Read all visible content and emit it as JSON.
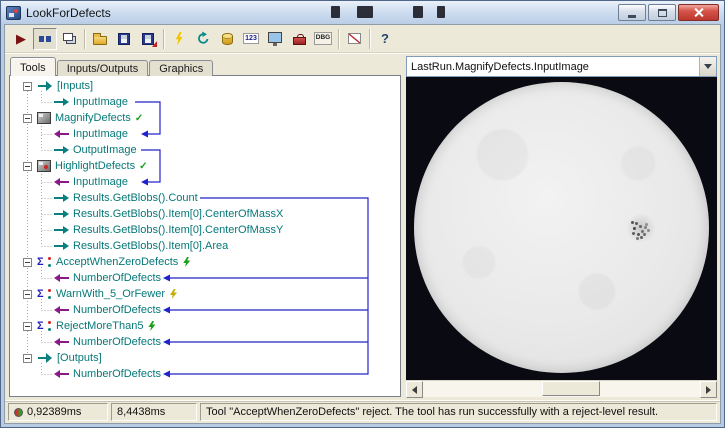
{
  "window": {
    "title": "LookForDefects"
  },
  "toolbar": {
    "buttons": [
      {
        "name": "run-job",
        "glyph": "▶"
      },
      {
        "name": "run-continuous",
        "glyph": ""
      },
      {
        "name": "show-windows",
        "glyph": ""
      },
      {
        "name": "open-job",
        "glyph": ""
      },
      {
        "name": "save-job",
        "glyph": ""
      },
      {
        "name": "save-image",
        "glyph": ""
      },
      {
        "name": "reset",
        "glyph": ""
      },
      {
        "name": "refresh",
        "glyph": ""
      },
      {
        "name": "database",
        "glyph": ""
      },
      {
        "name": "posted-values",
        "glyph": "123"
      },
      {
        "name": "image-display",
        "glyph": ""
      },
      {
        "name": "tool-options",
        "glyph": ""
      },
      {
        "name": "debug",
        "glyph": "DBG"
      },
      {
        "name": "profile",
        "glyph": ""
      },
      {
        "name": "help",
        "glyph": "?"
      }
    ]
  },
  "tabs": [
    {
      "label": "Tools"
    },
    {
      "label": "Inputs/Outputs"
    },
    {
      "label": "Graphics"
    }
  ],
  "icons": {
    "sigma": "Σ",
    "check": "✓"
  },
  "tree": {
    "items": [
      {
        "label": "[Inputs]"
      },
      {
        "label": "InputImage"
      },
      {
        "label": "MagnifyDefects"
      },
      {
        "label": "InputImage"
      },
      {
        "label": "OutputImage"
      },
      {
        "label": "HighlightDefects"
      },
      {
        "label": "InputImage"
      },
      {
        "label": "Results.GetBlobs().Count"
      },
      {
        "label": "Results.GetBlobs().Item[0].CenterOfMassX"
      },
      {
        "label": "Results.GetBlobs().Item[0].CenterOfMassY"
      },
      {
        "label": "Results.GetBlobs().Item[0].Area"
      },
      {
        "label": "AcceptWhenZeroDefects"
      },
      {
        "label": "NumberOfDefects"
      },
      {
        "label": "WarnWith_5_OrFewer"
      },
      {
        "label": "NumberOfDefects"
      },
      {
        "label": "RejectMoreThan5"
      },
      {
        "label": "NumberOfDefects"
      },
      {
        "label": "[Outputs]"
      },
      {
        "label": "NumberOfDefects"
      }
    ]
  },
  "viewer": {
    "source": "LastRun.MagnifyDefects.InputImage"
  },
  "statusbar": {
    "timing1": "0,92389ms",
    "timing2": "8,4438ms",
    "message": "Tool \"AcceptWhenZeroDefects\" reject. The tool has run successfully with a reject-level result."
  },
  "colors": {
    "tree_text": "#067878",
    "connection_blue": "#2323cd",
    "input_arrow_purple": "#8a1a8a",
    "output_arrow_teal": "#0a8080",
    "pass_green": "#18a018",
    "warn_yellow": "#c2ae00"
  }
}
